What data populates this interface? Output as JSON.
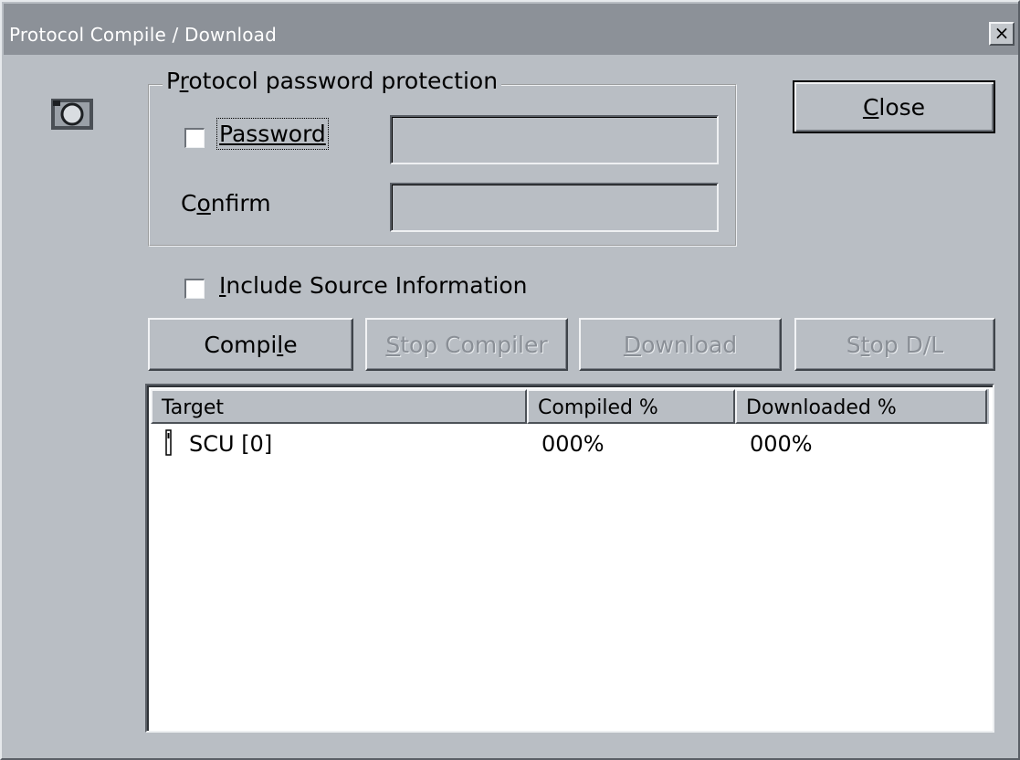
{
  "window": {
    "title": "Protocol Compile / Download",
    "close_glyph": "×"
  },
  "icons": {
    "app": "camera-circle-icon",
    "close": "close-icon",
    "row": "target-device-icon"
  },
  "password_group": {
    "legend_pre": "P",
    "legend_accel": "r",
    "legend_post": "otocol password protection",
    "password_label": "Password",
    "password_checked": false,
    "password_value": "",
    "confirm_pre": "C",
    "confirm_accel": "o",
    "confirm_post": "nfirm",
    "confirm_value": ""
  },
  "include_source": {
    "label_accel": "I",
    "label_post": "nclude Source Information",
    "checked": false
  },
  "buttons": {
    "close": {
      "accel": "C",
      "rest": "lose"
    },
    "compile": {
      "pre": "Compi",
      "accel": "l",
      "post": "e"
    },
    "stop_compiler": {
      "accel": "S",
      "rest": "top Compiler",
      "enabled": false
    },
    "download": {
      "accel": "D",
      "rest": "ownload",
      "enabled": false
    },
    "stop_dl": {
      "pre": "S",
      "accel": "t",
      "post": "op D/L",
      "enabled": false
    }
  },
  "table": {
    "columns": [
      "Target",
      "Compiled %",
      "Downloaded %"
    ],
    "rows": [
      {
        "target": "SCU [0]",
        "compiled": "000%",
        "downloaded": "000%"
      }
    ]
  },
  "colors": {
    "face": "#b9bec4",
    "title_bar": "#8c9198",
    "list_bg": "#ffffff",
    "disabled_text": "#8a8f96"
  }
}
